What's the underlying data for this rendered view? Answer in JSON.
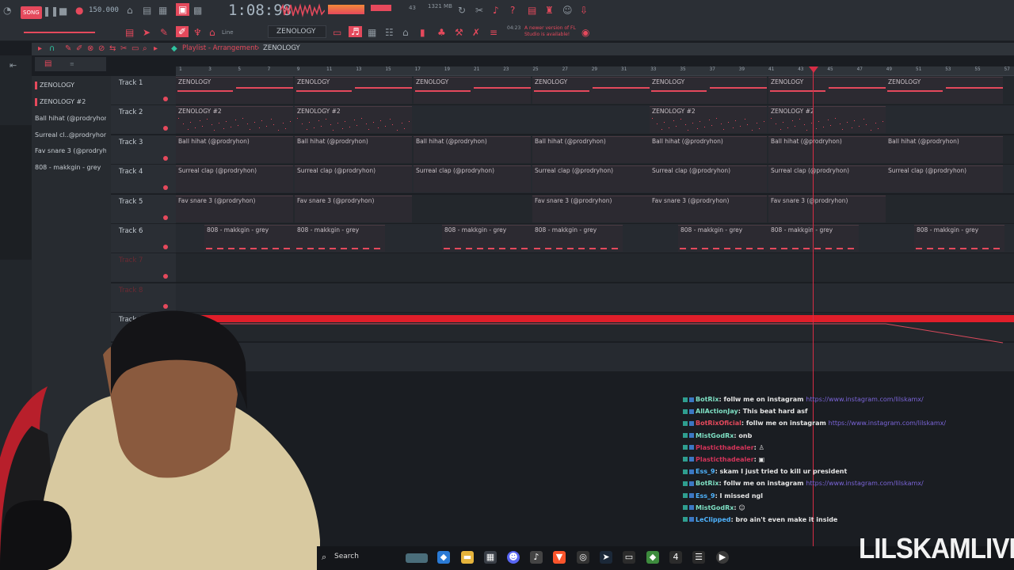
{
  "toolbar": {
    "mode": "SONG",
    "tempo": "150.000",
    "time": "1:08:98",
    "cpu": "1321 MB",
    "voices": "43",
    "snap": "Line",
    "pattern": "ZENOLOGY",
    "notice_time": "04:23",
    "notice": "A newer version of FL Studio is available!"
  },
  "playlist": {
    "breadcrumb": "Playlist - Arrangement",
    "pattern": "ZENOLOGY"
  },
  "patterns": [
    {
      "label": "ZENOLOGY"
    },
    {
      "label": "ZENOLOGY #2"
    },
    {
      "label": "Ball hihat (@prodryhon)"
    },
    {
      "label": "Surreal cl..@prodryhon)"
    },
    {
      "label": "Fav snare 3 (@prodryhon)"
    },
    {
      "label": "808 - makkgin - grey"
    }
  ],
  "ruler": [
    "1",
    "3",
    "5",
    "7",
    "9",
    "11",
    "13",
    "15",
    "17",
    "19",
    "21",
    "23",
    "25",
    "27",
    "29",
    "31",
    "33",
    "35",
    "37",
    "39",
    "41",
    "43",
    "45",
    "47",
    "49",
    "51",
    "53",
    "55",
    "57"
  ],
  "tracks": [
    {
      "name": "Track 1"
    },
    {
      "name": "Track 2"
    },
    {
      "name": "Track 3"
    },
    {
      "name": "Track 4"
    },
    {
      "name": "Track 5"
    },
    {
      "name": "Track 6"
    },
    {
      "name": "Track 7"
    },
    {
      "name": "Track 8"
    },
    {
      "name": "Track 9"
    },
    {
      "name": "Track 10"
    }
  ],
  "clips": {
    "t1": "ZENOLOGY",
    "t2": "ZENOLOGY #2",
    "t3": "Ball hihat (@prodryhon)",
    "t4": "Surreal clap (@prodryhon)",
    "t5": "Fav snare 3 (@prodryhon)",
    "t6": "808 - makkgin - grey"
  },
  "chat": [
    {
      "user": "BotRix",
      "text": ": follw me on instagram",
      "link": "https://www.instagram.com/lilskamx/"
    },
    {
      "user": "AllActionJay",
      "text": ": This beat hard asf",
      "link": ""
    },
    {
      "user": "BotRixOficial",
      "text": ": follw me on instagram",
      "link": "https://www.instagram.com/lilskamx/"
    },
    {
      "user": "MistGodRx",
      "text": ": onb",
      "link": ""
    },
    {
      "user": "Plasticthadealer",
      "text": ": ♙",
      "link": ""
    },
    {
      "user": "Plasticthadealer",
      "text": ": ▣",
      "link": ""
    },
    {
      "user": "Ess_9",
      "text": ": skam I just tried to kill ur president",
      "link": ""
    },
    {
      "user": "BotRix",
      "text": ": follw me on instagram",
      "link": "https://www.instagram.com/lilskamx/"
    },
    {
      "user": "Ess_9",
      "text": ": I missed ngl",
      "link": ""
    },
    {
      "user": "MistGodRx",
      "text": ": ☺",
      "link": ""
    },
    {
      "user": "LeClipped",
      "text": ": bro ain't even make it inside",
      "link": ""
    }
  ],
  "taskbar": {
    "search": "Search"
  },
  "watermark": "LILSKAMLIVE",
  "colors": {
    "accent": "#e5495c",
    "bg": "#23272c",
    "automation": "#e01e2a"
  }
}
